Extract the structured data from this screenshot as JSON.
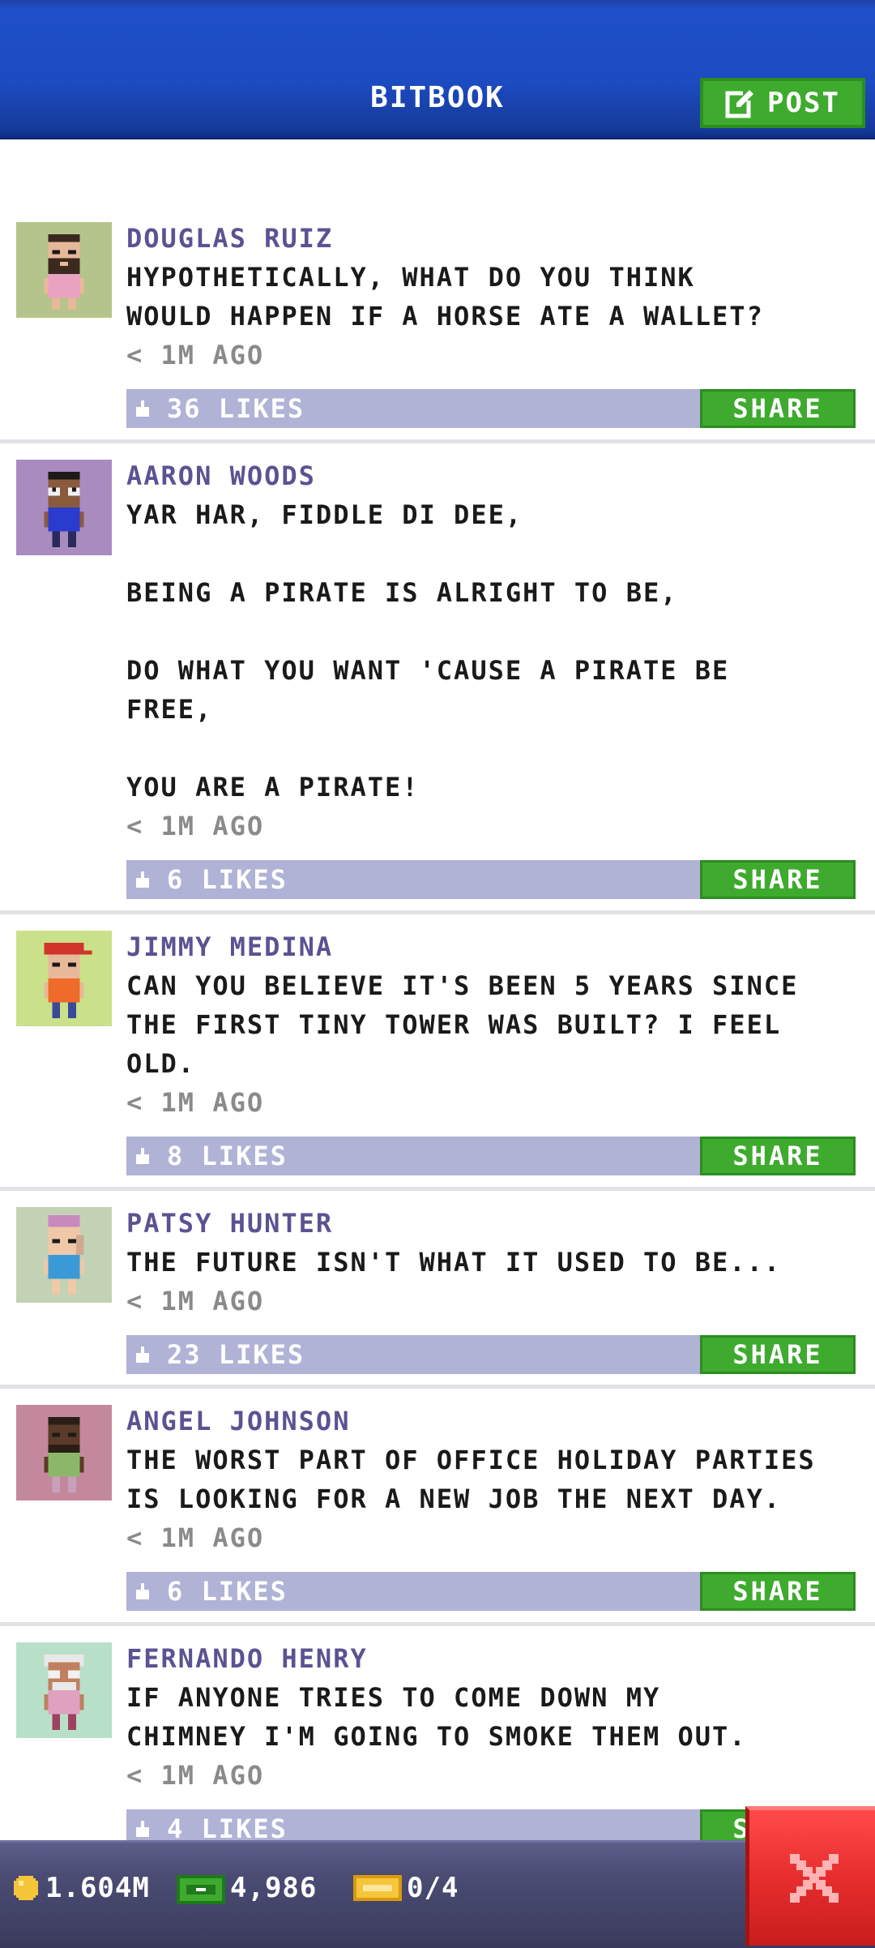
{
  "header": {
    "title": "BITBOOK",
    "post_label": "POST"
  },
  "posts": [
    {
      "author": "DOUGLAS RUIZ",
      "message": "HYPOTHETICALLY, WHAT DO YOU THINK\nWOULD HAPPEN IF A HORSE ATE A WALLET?",
      "time": "< 1M AGO",
      "likes": "36 LIKES",
      "share": "SHARE",
      "avatar_bg": "#b5c48a"
    },
    {
      "author": "AARON WOODS",
      "message": "YAR HAR, FIDDLE DI DEE,\n\nBEING A PIRATE IS ALRIGHT TO BE,\n\nDO WHAT YOU WANT 'CAUSE A PIRATE BE\nFREE,\n\nYOU ARE A PIRATE!",
      "time": "< 1M AGO",
      "likes": "6 LIKES",
      "share": "SHARE",
      "avatar_bg": "#a98bbf"
    },
    {
      "author": "JIMMY MEDINA",
      "message": "CAN YOU BELIEVE IT'S BEEN 5 YEARS SINCE\nTHE FIRST TINY TOWER WAS BUILT? I FEEL\nOLD.",
      "time": "< 1M AGO",
      "likes": "8 LIKES",
      "share": "SHARE",
      "avatar_bg": "#cbe08a"
    },
    {
      "author": "PATSY HUNTER",
      "message": "THE FUTURE ISN'T WHAT IT USED TO BE...",
      "time": "< 1M AGO",
      "likes": "23 LIKES",
      "share": "SHARE",
      "avatar_bg": "#c3d2b4"
    },
    {
      "author": "ANGEL JOHNSON",
      "message": "THE WORST PART OF OFFICE HOLIDAY PARTIES\nIS LOOKING FOR A NEW JOB THE NEXT DAY.",
      "time": "< 1M AGO",
      "likes": "6 LIKES",
      "share": "SHARE",
      "avatar_bg": "#c4889c"
    },
    {
      "author": "FERNANDO HENRY",
      "message": "IF ANYONE TRIES TO COME DOWN MY\nCHIMNEY I'M GOING TO SMOKE THEM OUT.",
      "time": "< 1M AGO",
      "likes": "4 LIKES",
      "share": "SHARE",
      "avatar_bg": "#b8e0c8"
    }
  ],
  "bottom_bar": {
    "coins": "1.604M",
    "bux": "4,986",
    "tickets": "0/4"
  },
  "colors": {
    "header_blue": "#1c4bc2",
    "accent_green": "#3eaa2e",
    "likes_bar": "#b0b2d6",
    "author_purple": "#5a5392",
    "close_red": "#e72d2d"
  }
}
